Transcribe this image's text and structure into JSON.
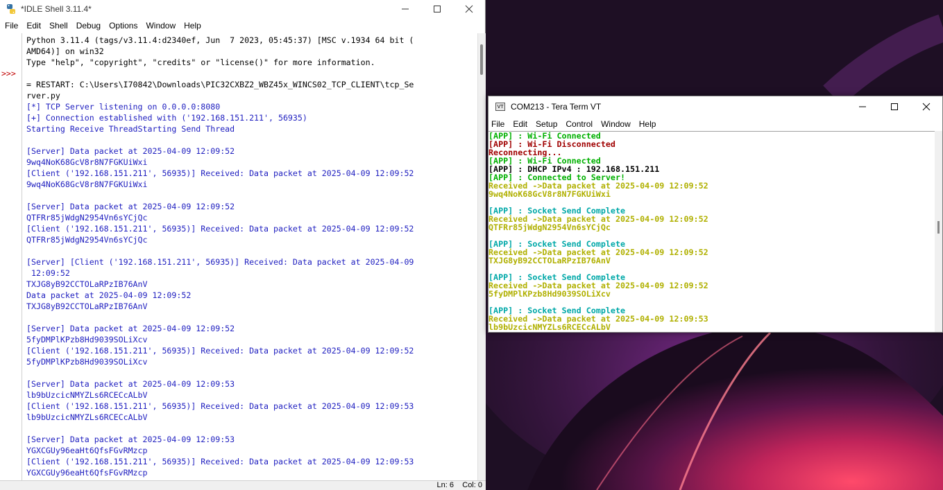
{
  "desktop": {
    "wallpaper": "windows-11-bloom"
  },
  "idle": {
    "title": "*IDLE Shell 3.11.4*",
    "menu": [
      "File",
      "Edit",
      "Shell",
      "Debug",
      "Options",
      "Window",
      "Help"
    ],
    "prompt": ">>>",
    "lines": [
      {
        "text": "Python 3.11.4 (tags/v3.11.4:d2340ef, Jun  7 2023, 05:45:37) [MSC v.1934 64 bit (",
        "color": "out"
      },
      {
        "text": "AMD64)] on win32",
        "color": "out"
      },
      {
        "text": "Type \"help\", \"copyright\", \"credits\" or \"license()\" for more information.",
        "color": "out"
      },
      {
        "text": "",
        "color": "out"
      },
      {
        "text": "= RESTART: C:\\Users\\I70842\\Downloads\\PIC32CXBZ2_WBZ45x_WINCS02_TCP_CLIENT\\tcp_Se",
        "color": "out"
      },
      {
        "text": "rver.py",
        "color": "out"
      },
      {
        "text": "[*] TCP Server listening on 0.0.0.0:8080",
        "color": "std"
      },
      {
        "text": "[+] Connection established with ('192.168.151.211', 56935)",
        "color": "std"
      },
      {
        "text": "Starting Receive ThreadStarting Send Thread",
        "color": "std"
      },
      {
        "text": "",
        "color": "std"
      },
      {
        "text": "[Server] Data packet at 2025-04-09 12:09:52",
        "color": "std"
      },
      {
        "text": "9wq4NoK68GcV8r8N7FGKUiWxi",
        "color": "std"
      },
      {
        "text": "[Client ('192.168.151.211', 56935)] Received: Data packet at 2025-04-09 12:09:52",
        "color": "std"
      },
      {
        "text": "9wq4NoK68GcV8r8N7FGKUiWxi",
        "color": "std"
      },
      {
        "text": "",
        "color": "std"
      },
      {
        "text": "[Server] Data packet at 2025-04-09 12:09:52",
        "color": "std"
      },
      {
        "text": "QTFRr85jWdgN2954Vn6sYCjQc",
        "color": "std"
      },
      {
        "text": "[Client ('192.168.151.211', 56935)] Received: Data packet at 2025-04-09 12:09:52",
        "color": "std"
      },
      {
        "text": "QTFRr85jWdgN2954Vn6sYCjQc",
        "color": "std"
      },
      {
        "text": "",
        "color": "std"
      },
      {
        "text": "[Server] [Client ('192.168.151.211', 56935)] Received: Data packet at 2025-04-09",
        "color": "std"
      },
      {
        "text": " 12:09:52",
        "color": "std"
      },
      {
        "text": "TXJG8yB92CCTOLaRPzIB76AnV",
        "color": "std"
      },
      {
        "text": "Data packet at 2025-04-09 12:09:52",
        "color": "std"
      },
      {
        "text": "TXJG8yB92CCTOLaRPzIB76AnV",
        "color": "std"
      },
      {
        "text": "",
        "color": "std"
      },
      {
        "text": "[Server] Data packet at 2025-04-09 12:09:52",
        "color": "std"
      },
      {
        "text": "5fyDMPlKPzb8Hd9039SOLiXcv",
        "color": "std"
      },
      {
        "text": "[Client ('192.168.151.211', 56935)] Received: Data packet at 2025-04-09 12:09:52",
        "color": "std"
      },
      {
        "text": "5fyDMPlKPzb8Hd9039SOLiXcv",
        "color": "std"
      },
      {
        "text": "",
        "color": "std"
      },
      {
        "text": "[Server] Data packet at 2025-04-09 12:09:53",
        "color": "std"
      },
      {
        "text": "lb9bUzcicNMYZLs6RCECcALbV",
        "color": "std"
      },
      {
        "text": "[Client ('192.168.151.211', 56935)] Received: Data packet at 2025-04-09 12:09:53",
        "color": "std"
      },
      {
        "text": "lb9bUzcicNMYZLs6RCECcALbV",
        "color": "std"
      },
      {
        "text": "",
        "color": "std"
      },
      {
        "text": "[Server] Data packet at 2025-04-09 12:09:53",
        "color": "std"
      },
      {
        "text": "YGXCGUy96eaHt6QfsFGvRMzcp",
        "color": "std"
      },
      {
        "text": "[Client ('192.168.151.211', 56935)] Received: Data packet at 2025-04-09 12:09:53",
        "color": "std"
      },
      {
        "text": "YGXCGUy96eaHt6QfsFGvRMzcp",
        "color": "std"
      }
    ],
    "status": {
      "ln": "Ln: 6",
      "col": "Col: 0"
    }
  },
  "teraterm": {
    "title": "COM213 - Tera Term VT",
    "icon_label": "VT",
    "menu": [
      "File",
      "Edit",
      "Setup",
      "Control",
      "Window",
      "Help"
    ],
    "lines": [
      {
        "text": "[APP] : Wi-Fi Connected",
        "color": "green"
      },
      {
        "text": "[APP] : Wi-Fi Disconnected",
        "color": "red"
      },
      {
        "text": "Reconnecting...",
        "color": "red"
      },
      {
        "text": "[APP] : Wi-Fi Connected",
        "color": "green"
      },
      {
        "text": "[APP] : DHCP IPv4 : 192.168.151.211",
        "color": "black"
      },
      {
        "text": "[APP] : Connected to Server!",
        "color": "green"
      },
      {
        "text": "Received ->Data packet at 2025-04-09 12:09:52",
        "color": "yellow"
      },
      {
        "text": "9wq4NoK68GcV8r8N7FGKUiWxi",
        "color": "yellow"
      },
      {
        "text": "",
        "color": "black"
      },
      {
        "text": "[APP] : Socket Send Complete",
        "color": "cyan"
      },
      {
        "text": "Received ->Data packet at 2025-04-09 12:09:52",
        "color": "yellow"
      },
      {
        "text": "QTFRr85jWdgN2954Vn6sYCjQc",
        "color": "yellow"
      },
      {
        "text": "",
        "color": "black"
      },
      {
        "text": "[APP] : Socket Send Complete",
        "color": "cyan"
      },
      {
        "text": "Received ->Data packet at 2025-04-09 12:09:52",
        "color": "yellow"
      },
      {
        "text": "TXJG8yB92CCTOLaRPzIB76AnV",
        "color": "yellow"
      },
      {
        "text": "",
        "color": "black"
      },
      {
        "text": "[APP] : Socket Send Complete",
        "color": "cyan"
      },
      {
        "text": "Received ->Data packet at 2025-04-09 12:09:52",
        "color": "yellow"
      },
      {
        "text": "5fyDMPlKPzb8Hd9039SOLiXcv",
        "color": "yellow"
      },
      {
        "text": "",
        "color": "black"
      },
      {
        "text": "[APP] : Socket Send Complete",
        "color": "cyan"
      },
      {
        "text": "Received ->Data packet at 2025-04-09 12:09:53",
        "color": "yellow"
      },
      {
        "text": "lb9bUzcicNMYZLs6RCECcALbV",
        "color": "yellow"
      }
    ]
  },
  "colors": {
    "idle_std": "#2020c0",
    "tt_green": "#00b000",
    "tt_red": "#a00000",
    "tt_yellow": "#b0b000",
    "tt_cyan": "#00a8a8"
  }
}
